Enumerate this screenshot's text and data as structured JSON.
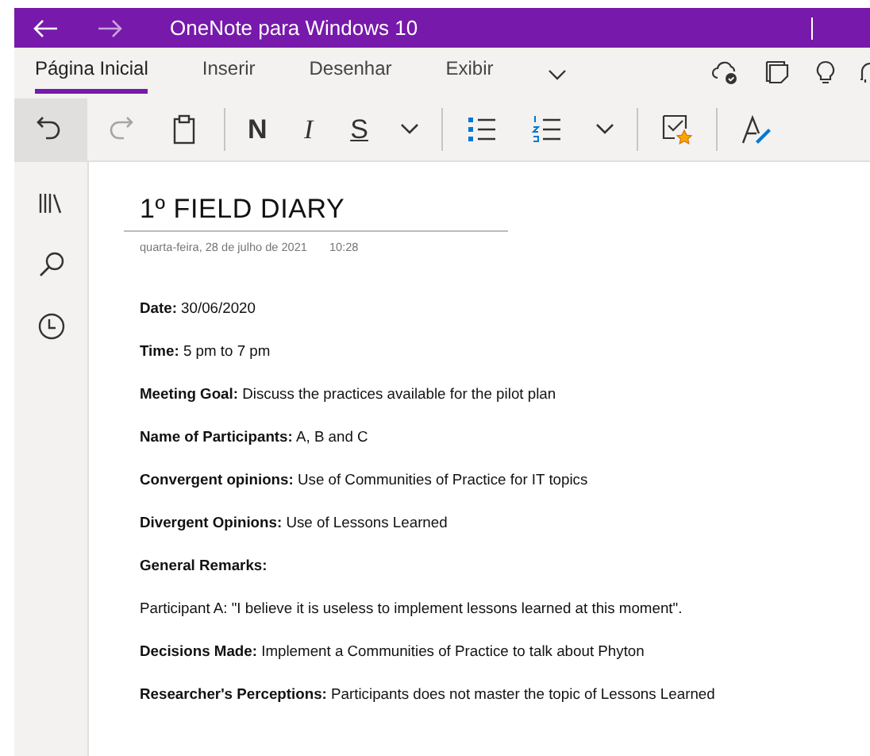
{
  "window": {
    "title": "OneNote para Windows 10"
  },
  "tabs": [
    {
      "label": "Página Inicial",
      "selected": true
    },
    {
      "label": "Inserir",
      "selected": false
    },
    {
      "label": "Desenhar",
      "selected": false
    },
    {
      "label": "Exibir",
      "selected": false
    }
  ],
  "toolbar": [
    {
      "kind": "undo",
      "pressed": true,
      "disabled": false
    },
    {
      "kind": "redo",
      "pressed": false,
      "disabled": true
    },
    {
      "kind": "paste",
      "pressed": false,
      "disabled": false
    },
    {
      "kind": "separator"
    },
    {
      "kind": "bold",
      "label": "N",
      "pressed": false,
      "disabled": false
    },
    {
      "kind": "italic",
      "label": "I",
      "pressed": false,
      "disabled": false
    },
    {
      "kind": "underline",
      "label": "S",
      "pressed": false,
      "disabled": false
    },
    {
      "kind": "chevron",
      "pressed": false,
      "disabled": false
    },
    {
      "kind": "separator"
    },
    {
      "kind": "bullets",
      "pressed": false,
      "disabled": false
    },
    {
      "kind": "numbering",
      "pressed": false,
      "disabled": false
    },
    {
      "kind": "chevron",
      "pressed": false,
      "disabled": false
    },
    {
      "kind": "separator"
    },
    {
      "kind": "tag",
      "pressed": false,
      "disabled": false
    },
    {
      "kind": "separator"
    },
    {
      "kind": "styles",
      "pressed": false,
      "disabled": false
    }
  ],
  "page": {
    "title": "1º FIELD DIARY",
    "date": "quarta-feira, 28 de julho de 2021",
    "time": "10:28",
    "paragraphs": [
      "**Date:** 30/06/2020",
      "**Time:** 5 pm to 7 pm",
      "**Meeting Goal:** Discuss the practices available for the pilot plan",
      "**Name of Participants:** A, B and C",
      "**Convergent opinions:** Use of Communities of Practice for IT topics",
      "**Divergent Opinions:** Use of Lessons Learned",
      "**General Remarks:**",
      "Participant A: \"I believe it is useless to implement lessons learned at this moment\".",
      "**Decisions Made:** Implement a Communities of Practice to talk about Phyton",
      "**Researcher's Perceptions:** Participants does not master the topic of Lessons Learned"
    ]
  }
}
